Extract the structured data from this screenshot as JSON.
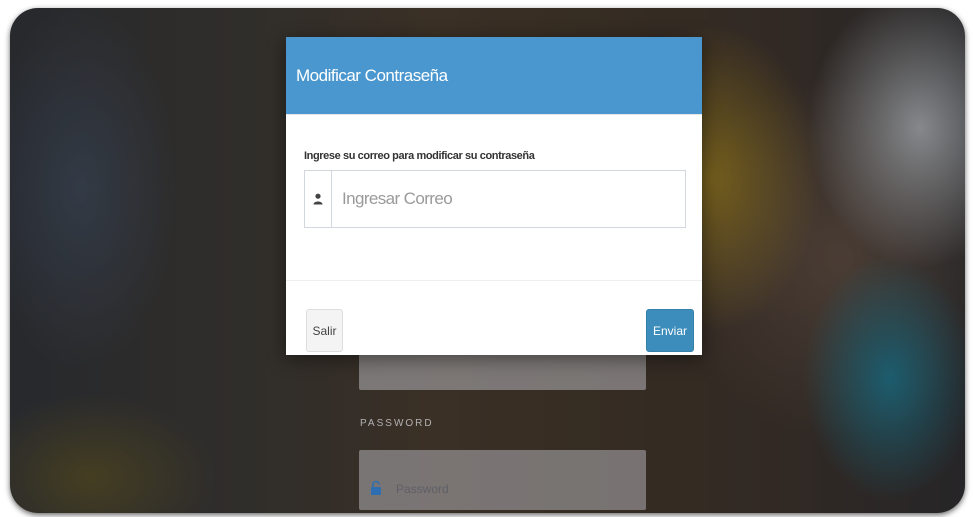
{
  "background_form": {
    "password_label": "PASSWORD",
    "password_placeholder": "Password"
  },
  "modal": {
    "title": "Modificar Contraseña",
    "field_label": "Ingrese su correo para modificar su contraseña",
    "email_placeholder": "Ingresar Correo",
    "email_value": "",
    "user_icon": "user-icon",
    "buttons": {
      "cancel_label": "Salir",
      "submit_label": "Enviar"
    }
  },
  "colors": {
    "header": "#4a97cf",
    "primary_button": "#3c8dbc",
    "default_button": "#f4f4f4"
  }
}
